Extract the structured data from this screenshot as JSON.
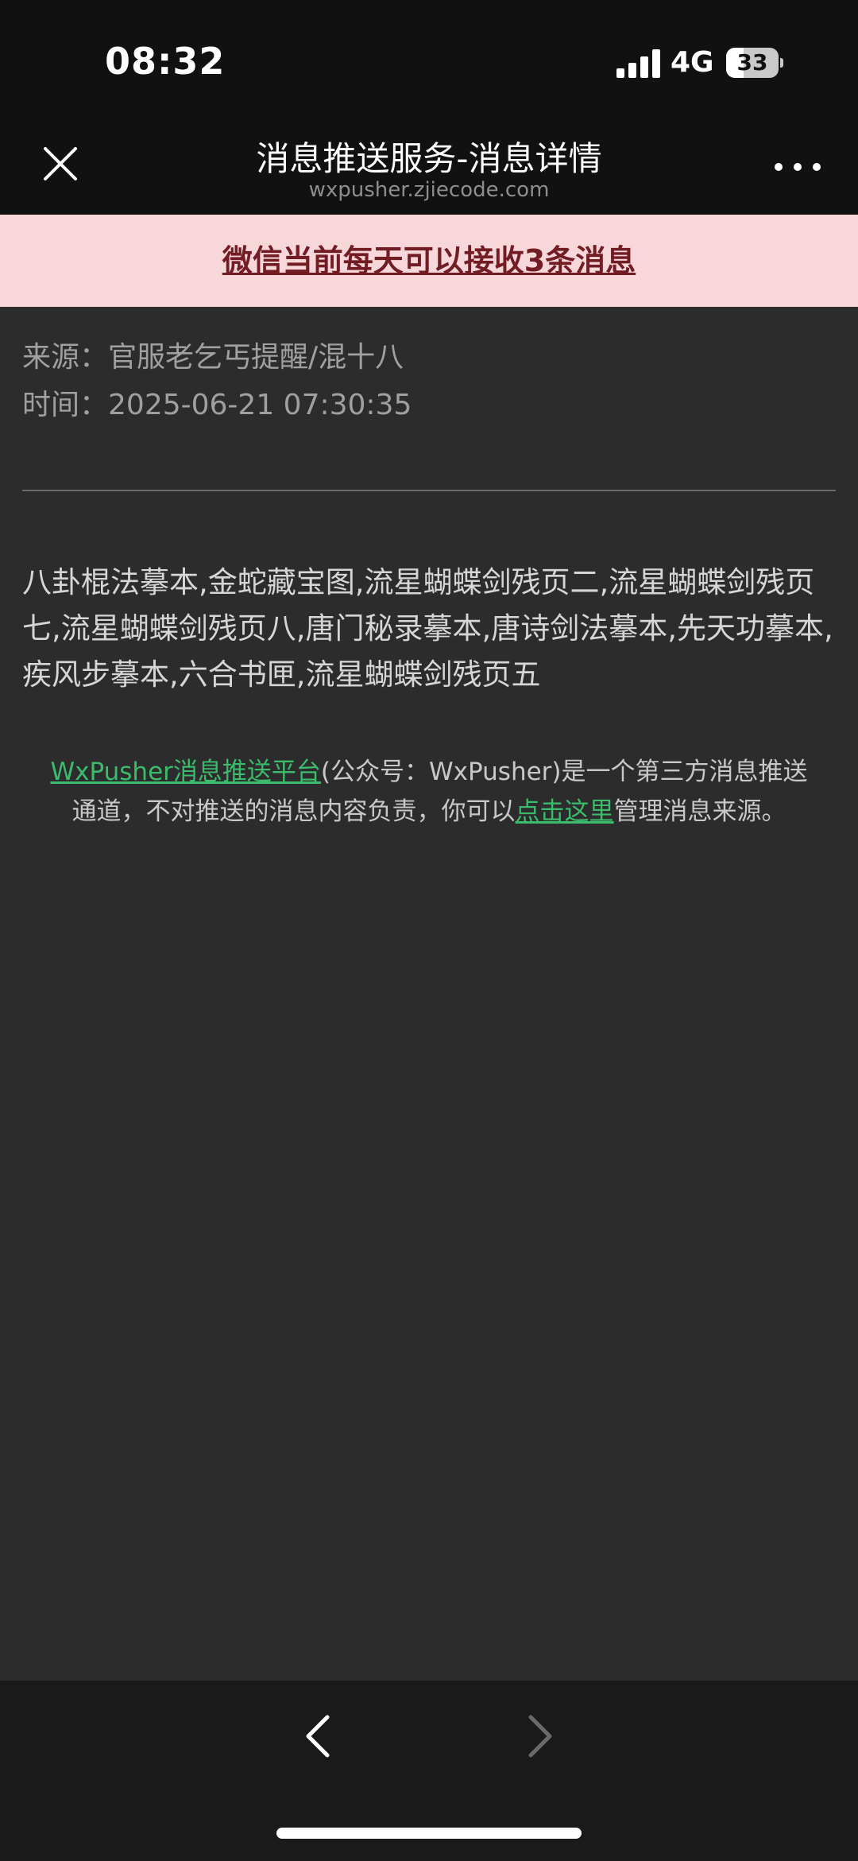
{
  "status_bar": {
    "time": "08:32",
    "network": "4G",
    "battery_level": "33",
    "battery_fraction": 0.33,
    "signal_icon": "signal-bars-icon",
    "battery_icon": "battery-icon"
  },
  "header": {
    "title": "消息推送服务-消息详情",
    "subtitle": "wxpusher.zjiecode.com",
    "close_icon": "close-icon",
    "more_icon": "more-dots-icon"
  },
  "banner": {
    "text": "微信当前每天可以接收3条消息"
  },
  "meta": {
    "source_label": "来源：",
    "source_value": "官服老乞丐提醒/混十八",
    "time_label": "时间：",
    "time_value": "2025-06-21 07:30:35"
  },
  "message": {
    "body": "八卦棍法摹本,金蛇藏宝图,流星蝴蝶剑残页二,流星蝴蝶剑残页七,流星蝴蝶剑残页八,唐门秘录摹本,唐诗剑法摹本,先天功摹本,疾风步摹本,六合书匣,流星蝴蝶剑残页五"
  },
  "footer": {
    "platform_link": "WxPusher消息推送平台",
    "text_part1": "(公众号：WxPusher)是一个第三方消息推送通道，不对推送的消息内容负责，你可以",
    "manage_link": "点击这里",
    "text_part2": "管理消息来源。"
  },
  "toolbar": {
    "back_icon": "chevron-left-icon",
    "forward_icon": "chevron-right-icon"
  },
  "colors": {
    "banner_bg": "#f8d7da",
    "banner_text": "#721c24",
    "link": "#3dbb6d",
    "page_bg": "#2c2c2c",
    "bar_bg": "#111111"
  }
}
